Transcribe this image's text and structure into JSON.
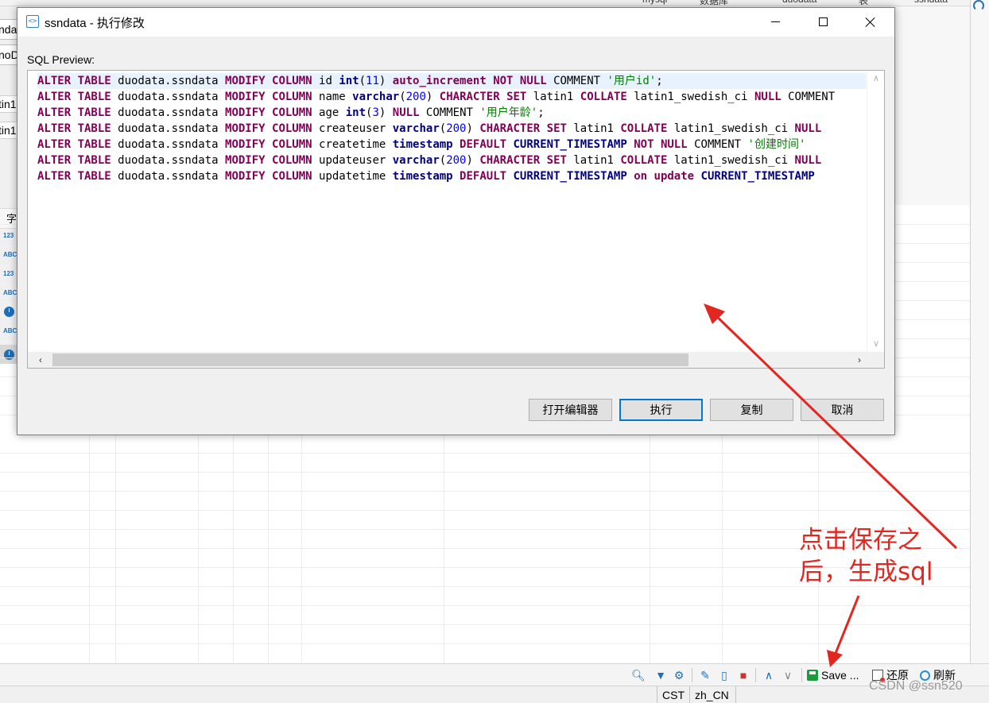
{
  "background": {
    "top_tabs": [
      "mysql",
      "数据库",
      "duodata",
      "表",
      "ssndata"
    ],
    "left_fragments": [
      "nda",
      "noD",
      "tin1",
      "tin1"
    ],
    "left_column_header": "字",
    "left_type_icons": [
      "123",
      "ABC",
      "123",
      "ABC",
      "clock",
      "ABC",
      "clock"
    ]
  },
  "dialog": {
    "title": "ssndata - 执行修改",
    "preview_label": "SQL Preview:",
    "sql_lines": [
      [
        [
          "kw",
          "ALTER TABLE"
        ],
        [
          "pl",
          " duodata.ssndata "
        ],
        [
          "kw",
          "MODIFY COLUMN"
        ],
        [
          "pl",
          " id "
        ],
        [
          "ty",
          "int"
        ],
        [
          "pl",
          "("
        ],
        [
          "num",
          "11"
        ],
        [
          "pl",
          ") "
        ],
        [
          "kw",
          "auto_increment NOT NULL"
        ],
        [
          "pl",
          " COMMENT "
        ],
        [
          "str",
          "'用户id'"
        ],
        [
          "pl",
          ";"
        ]
      ],
      [
        [
          "kw",
          "ALTER TABLE"
        ],
        [
          "pl",
          " duodata.ssndata "
        ],
        [
          "kw",
          "MODIFY COLUMN"
        ],
        [
          "pl",
          " name "
        ],
        [
          "ty",
          "varchar"
        ],
        [
          "pl",
          "("
        ],
        [
          "num",
          "200"
        ],
        [
          "pl",
          ") "
        ],
        [
          "kw",
          "CHARACTER SET"
        ],
        [
          "pl",
          " latin1 "
        ],
        [
          "kw",
          "COLLATE"
        ],
        [
          "pl",
          " latin1_swedish_ci "
        ],
        [
          "kw",
          "NULL"
        ],
        [
          "pl",
          " COMMENT"
        ]
      ],
      [
        [
          "kw",
          "ALTER TABLE"
        ],
        [
          "pl",
          " duodata.ssndata "
        ],
        [
          "kw",
          "MODIFY COLUMN"
        ],
        [
          "pl",
          " age "
        ],
        [
          "ty",
          "int"
        ],
        [
          "pl",
          "("
        ],
        [
          "num",
          "3"
        ],
        [
          "pl",
          ") "
        ],
        [
          "kw",
          "NULL"
        ],
        [
          "pl",
          " COMMENT "
        ],
        [
          "str",
          "'用户年龄'"
        ],
        [
          "pl",
          ";"
        ]
      ],
      [
        [
          "kw",
          "ALTER TABLE"
        ],
        [
          "pl",
          " duodata.ssndata "
        ],
        [
          "kw",
          "MODIFY COLUMN"
        ],
        [
          "pl",
          " createuser "
        ],
        [
          "ty",
          "varchar"
        ],
        [
          "pl",
          "("
        ],
        [
          "num",
          "200"
        ],
        [
          "pl",
          ") "
        ],
        [
          "kw",
          "CHARACTER SET"
        ],
        [
          "pl",
          " latin1 "
        ],
        [
          "kw",
          "COLLATE"
        ],
        [
          "pl",
          " latin1_swedish_ci "
        ],
        [
          "kw",
          "NULL"
        ]
      ],
      [
        [
          "kw",
          "ALTER TABLE"
        ],
        [
          "pl",
          " duodata.ssndata "
        ],
        [
          "kw",
          "MODIFY COLUMN"
        ],
        [
          "pl",
          " createtime "
        ],
        [
          "ty",
          "timestamp"
        ],
        [
          "pl",
          " "
        ],
        [
          "kw",
          "DEFAULT"
        ],
        [
          "pl",
          " "
        ],
        [
          "ty",
          "CURRENT_TIMESTAMP"
        ],
        [
          "pl",
          " "
        ],
        [
          "kw",
          "NOT NULL"
        ],
        [
          "pl",
          " COMMENT "
        ],
        [
          "str",
          "'创建时间'"
        ]
      ],
      [
        [
          "kw",
          "ALTER TABLE"
        ],
        [
          "pl",
          " duodata.ssndata "
        ],
        [
          "kw",
          "MODIFY COLUMN"
        ],
        [
          "pl",
          " updateuser "
        ],
        [
          "ty",
          "varchar"
        ],
        [
          "pl",
          "("
        ],
        [
          "num",
          "200"
        ],
        [
          "pl",
          ") "
        ],
        [
          "kw",
          "CHARACTER SET"
        ],
        [
          "pl",
          " latin1 "
        ],
        [
          "kw",
          "COLLATE"
        ],
        [
          "pl",
          " latin1_swedish_ci "
        ],
        [
          "kw",
          "NULL"
        ]
      ],
      [
        [
          "kw",
          "ALTER TABLE"
        ],
        [
          "pl",
          " duodata.ssndata "
        ],
        [
          "kw",
          "MODIFY COLUMN"
        ],
        [
          "pl",
          " updatetime "
        ],
        [
          "ty",
          "timestamp"
        ],
        [
          "pl",
          " "
        ],
        [
          "kw",
          "DEFAULT"
        ],
        [
          "pl",
          " "
        ],
        [
          "ty",
          "CURRENT_TIMESTAMP"
        ],
        [
          "pl",
          " "
        ],
        [
          "kw",
          "on update"
        ],
        [
          "pl",
          " "
        ],
        [
          "ty",
          "CURRENT_TIMESTAMP"
        ]
      ]
    ],
    "buttons": {
      "open_editor": "打开编辑器",
      "execute": "执行",
      "copy": "复制",
      "cancel": "取消"
    }
  },
  "toolbar": {
    "save_label": "Save ...",
    "revert_label": "还原",
    "refresh_label": "刷新"
  },
  "statusbar": {
    "timezone": "CST",
    "locale": "zh_CN"
  },
  "annotation": {
    "text": "点击保存之后，生成sql",
    "color": "#e3261f"
  },
  "watermark": "CSDN @ssn520"
}
